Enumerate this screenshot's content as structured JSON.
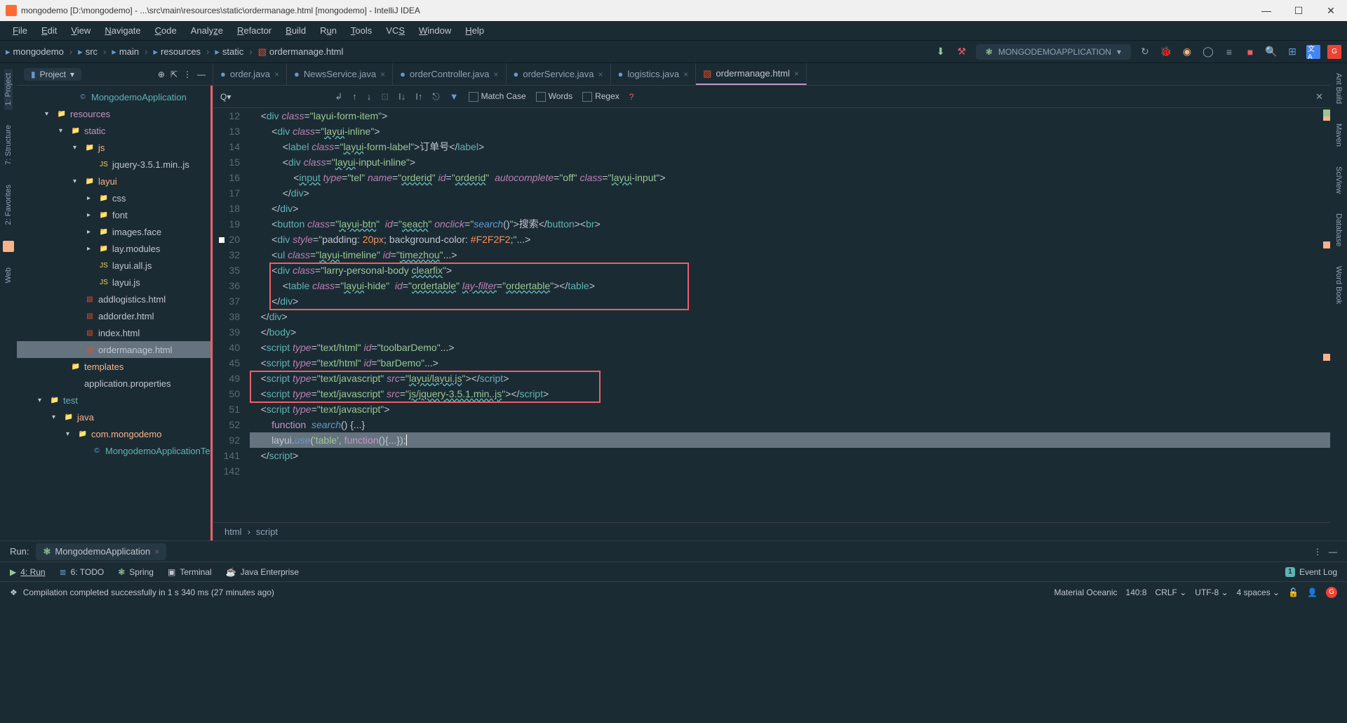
{
  "titlebar": {
    "text": "mongodemo [D:\\mongodemo] - ...\\src\\main\\resources\\static\\ordermanage.html [mongodemo] - IntelliJ IDEA"
  },
  "menubar": [
    "File",
    "Edit",
    "View",
    "Navigate",
    "Code",
    "Analyze",
    "Refactor",
    "Build",
    "Run",
    "Tools",
    "VCS",
    "Window",
    "Help"
  ],
  "breadcrumbs": [
    {
      "icon": "folder",
      "label": "mongodemo"
    },
    {
      "icon": "folder",
      "label": "src"
    },
    {
      "icon": "folder",
      "label": "main"
    },
    {
      "icon": "folder",
      "label": "resources"
    },
    {
      "icon": "folder",
      "label": "static"
    },
    {
      "icon": "html",
      "label": "ordermanage.html"
    }
  ],
  "runconfig": {
    "label": "MONGODEMOAPPLICATION"
  },
  "project": {
    "header": "Project"
  },
  "tree": [
    {
      "indent": 70,
      "chev": "",
      "icon": "class",
      "label": "MongodemoApplication",
      "cls": "cyan"
    },
    {
      "indent": 40,
      "chev": "▾",
      "icon": "folder",
      "label": "resources",
      "cls": "pink"
    },
    {
      "indent": 60,
      "chev": "▾",
      "icon": "folder",
      "label": "static",
      "cls": "pink"
    },
    {
      "indent": 80,
      "chev": "▾",
      "icon": "folder",
      "label": "js",
      "cls": "yellow-txt"
    },
    {
      "indent": 100,
      "chev": "",
      "icon": "js",
      "label": "jquery-3.5.1.min..js",
      "cls": ""
    },
    {
      "indent": 80,
      "chev": "▾",
      "icon": "folder",
      "label": "layui",
      "cls": "yellow-txt"
    },
    {
      "indent": 100,
      "chev": "▸",
      "icon": "folder",
      "label": "css",
      "cls": ""
    },
    {
      "indent": 100,
      "chev": "▸",
      "icon": "folder",
      "label": "font",
      "cls": ""
    },
    {
      "indent": 100,
      "chev": "▸",
      "icon": "folder",
      "label": "images.face",
      "cls": ""
    },
    {
      "indent": 100,
      "chev": "▸",
      "icon": "folder",
      "label": "lay.modules",
      "cls": ""
    },
    {
      "indent": 100,
      "chev": "",
      "icon": "js",
      "label": "layui.all.js",
      "cls": ""
    },
    {
      "indent": 100,
      "chev": "",
      "icon": "js",
      "label": "layui.js",
      "cls": ""
    },
    {
      "indent": 80,
      "chev": "",
      "icon": "html",
      "label": "addlogistics.html",
      "cls": ""
    },
    {
      "indent": 80,
      "chev": "",
      "icon": "html",
      "label": "addorder.html",
      "cls": ""
    },
    {
      "indent": 80,
      "chev": "",
      "icon": "html",
      "label": "index.html",
      "cls": ""
    },
    {
      "indent": 80,
      "chev": "",
      "icon": "html",
      "label": "ordermanage.html",
      "cls": "",
      "selected": true
    },
    {
      "indent": 60,
      "chev": "",
      "icon": "folder",
      "label": "templates",
      "cls": "yellow-txt"
    },
    {
      "indent": 60,
      "chev": "",
      "icon": "xml",
      "label": "application.properties",
      "cls": ""
    },
    {
      "indent": 30,
      "chev": "▾",
      "icon": "folder",
      "label": "test",
      "cls": "cyan"
    },
    {
      "indent": 50,
      "chev": "▾",
      "icon": "folder",
      "label": "java",
      "cls": "yellow-txt"
    },
    {
      "indent": 70,
      "chev": "▾",
      "icon": "folder",
      "label": "com.mongodemo",
      "cls": "yellow-txt"
    },
    {
      "indent": 90,
      "chev": "",
      "icon": "class",
      "label": "MongodemoApplicationTe",
      "cls": "cyan"
    }
  ],
  "tabs": [
    {
      "icon": "java",
      "label": "order.java"
    },
    {
      "icon": "java",
      "label": "NewsService.java"
    },
    {
      "icon": "java",
      "label": "orderController.java"
    },
    {
      "icon": "java",
      "label": "orderService.java"
    },
    {
      "icon": "java",
      "label": "logistics.java"
    },
    {
      "icon": "html",
      "label": "ordermanage.html",
      "active": true
    }
  ],
  "find": {
    "placeholder": "Q▾",
    "match_case": "Match Case",
    "words": "Words",
    "regex": "Regex"
  },
  "code": {
    "lines": [
      {
        "n": 12,
        "html": "    <span class='t-brk'>&lt;</span><span class='t-tag'>div</span> <span class='t-attr'>class</span><span class='t-brk'>=</span><span class='t-str'>\"layui-form-item\"</span><span class='t-brk'>&gt;</span>"
      },
      {
        "n": 13,
        "html": "        <span class='t-brk'>&lt;</span><span class='t-tag'>div</span> <span class='t-attr'>class</span><span class='t-brk'>=</span><span class='t-str'>\"<span class='wavy'>layui</span>-inline\"</span><span class='t-brk'>&gt;</span>"
      },
      {
        "n": 14,
        "html": "            <span class='t-brk'>&lt;</span><span class='t-tag'>label</span> <span class='t-attr'>class</span><span class='t-brk'>=</span><span class='t-str'>\"<span class='wavy'>layui</span>-form-label\"</span><span class='t-brk'>&gt;</span><span class='t-txt'>订单号</span><span class='t-brk'>&lt;/</span><span class='t-tag'>label</span><span class='t-brk'>&gt;</span>"
      },
      {
        "n": 15,
        "html": "            <span class='t-brk'>&lt;</span><span class='t-tag'>div</span> <span class='t-attr'>class</span><span class='t-brk'>=</span><span class='t-str'>\"<span class='wavy'>layui</span>-input-inline\"</span><span class='t-brk'>&gt;</span>"
      },
      {
        "n": 16,
        "html": "                <span class='t-brk'>&lt;</span><span class='t-tag wavy'>input</span> <span class='t-attr'>type</span><span class='t-brk'>=</span><span class='t-str'>\"tel\"</span> <span class='t-attr'>name</span><span class='t-brk'>=</span><span class='t-str'>\"<span class='wavy'>orderid</span>\"</span> <span class='t-attr'>id</span><span class='t-brk'>=</span><span class='t-str'>\"<span class='wavy'>orderid</span>\"</span>  <span class='t-attr'>autocomplete</span><span class='t-brk'>=</span><span class='t-str'>\"off\"</span> <span class='t-attr'>class</span><span class='t-brk'>=</span><span class='t-str'>\"<span class='wavy'>layui</span>-input\"</span><span class='t-brk'>&gt;</span>"
      },
      {
        "n": 17,
        "html": "            <span class='t-brk'>&lt;/</span><span class='t-tag'>div</span><span class='t-brk'>&gt;</span>"
      },
      {
        "n": 18,
        "html": "        <span class='t-brk'>&lt;/</span><span class='t-tag'>div</span><span class='t-brk'>&gt;</span>"
      },
      {
        "n": 19,
        "html": "        <span class='t-brk'>&lt;</span><span class='t-tag'>button</span> <span class='t-attr'>class</span><span class='t-brk'>=</span><span class='t-str'>\"<span class='wavy'>layui-btn</span>\"</span>  <span class='t-attr'>id</span><span class='t-brk'>=</span><span class='t-str'>\"<span class='wavy'>seach</span>\"</span> <span class='t-attr'>onclick</span><span class='t-brk'>=</span><span class='t-str'>\"</span><span class='t-fn'>search</span><span class='t-brk'>()</span><span class='t-str'>\"</span><span class='t-brk'>&gt;</span><span class='t-txt'>搜索</span><span class='t-brk'>&lt;/</span><span class='t-tag'>button</span><span class='t-brk'>&gt;&lt;</span><span class='t-tag'>br</span><span class='t-brk'>&gt;</span>"
      },
      {
        "n": 20,
        "marker": true,
        "html": "        <span class='t-brk'>&lt;</span><span class='t-tag'>div</span> <span class='t-attr'>style</span><span class='t-brk'>=</span><span class='t-str'>\"</span><span class='t-txt'>padding: </span><span class='t-num'>20px</span><span class='t-txt'>; background-color: </span><span class='t-num'>#F2F2F2</span><span class='t-txt'>;</span><span class='t-str'>\"</span><span class='t-brk'>...&gt;</span>"
      },
      {
        "n": 32,
        "html": "        <span class='t-brk'>&lt;</span><span class='t-tag'>ul</span> <span class='t-attr'>class</span><span class='t-brk'>=</span><span class='t-str'>\"<span class='wavy'>layui</span>-timeline\"</span> <span class='t-attr'>id</span><span class='t-brk'>=</span><span class='t-str'>\"<span class='wavy'>timezhou</span>\"</span><span class='t-brk'>...&gt;</span>"
      },
      {
        "n": 35,
        "html": "        <span class='t-brk'>&lt;</span><span class='t-tag'>div</span> <span class='t-attr'>class</span><span class='t-brk'>=</span><span class='t-str'>\"larry-personal-body <span class='wavy'>clearfix</span>\"</span><span class='t-brk'>&gt;</span>"
      },
      {
        "n": 36,
        "html": "            <span class='t-brk'>&lt;</span><span class='t-tag'>table</span> <span class='t-attr'>class</span><span class='t-brk'>=</span><span class='t-str'>\"<span class='wavy'>layui</span>-hide\"</span>  <span class='t-attr'>id</span><span class='t-brk'>=</span><span class='t-str'>\"<span class='wavy'>ordertable</span>\"</span> <span class='t-attr wavy'>lay-filter</span><span class='t-brk'>=</span><span class='t-str'>\"<span class='wavy'>ordertable</span>\"</span><span class='t-brk'>&gt;&lt;/</span><span class='t-tag'>table</span><span class='t-brk'>&gt;</span>"
      },
      {
        "n": 37,
        "html": "        <span class='t-brk'>&lt;/</span><span class='t-tag'>div</span><span class='t-brk'>&gt;</span>"
      },
      {
        "n": 38,
        "html": "    <span class='t-brk'>&lt;/</span><span class='t-tag'>div</span><span class='t-brk'>&gt;</span>"
      },
      {
        "n": 39,
        "html": "    <span class='t-brk'>&lt;/</span><span class='t-tag'>body</span><span class='t-brk'>&gt;</span>"
      },
      {
        "n": 40,
        "html": "    <span class='t-brk'>&lt;</span><span class='t-tag'>script</span> <span class='t-attr'>type</span><span class='t-brk'>=</span><span class='t-str'>\"text/html\"</span> <span class='t-attr'>id</span><span class='t-brk'>=</span><span class='t-str'>\"toolbarDemo\"</span><span class='t-brk'>...&gt;</span>"
      },
      {
        "n": 45,
        "html": "    <span class='t-brk'>&lt;</span><span class='t-tag'>script</span> <span class='t-attr'>type</span><span class='t-brk'>=</span><span class='t-str'>\"text/html\"</span> <span class='t-attr'>id</span><span class='t-brk'>=</span><span class='t-str'>\"barDemo\"</span><span class='t-brk'>...&gt;</span>"
      },
      {
        "n": 49,
        "html": "    <span class='t-brk'>&lt;</span><span class='t-tag'>script</span> <span class='t-attr'>type</span><span class='t-brk'>=</span><span class='t-str'>\"text/javascript\"</span> <span class='t-attr'>src</span><span class='t-brk'>=</span><span class='t-str'>\"<span class='wavy'>layui/layui.js</span>\"</span><span class='t-brk'>&gt;&lt;/</span><span class='t-tag'>script</span><span class='t-brk'>&gt;</span>"
      },
      {
        "n": 50,
        "html": "    <span class='t-brk'>&lt;</span><span class='t-tag'>script</span> <span class='t-attr'>type</span><span class='t-brk'>=</span><span class='t-str'>\"text/javascript\"</span> <span class='t-attr'>src</span><span class='t-brk'>=</span><span class='t-str'>\"<span class='wavy'>js/jquery-3.5.1.min..js</span>\"</span><span class='t-brk'>&gt;&lt;/</span><span class='t-tag'>script</span><span class='t-brk'>&gt;</span>"
      },
      {
        "n": 51,
        "html": "    <span class='t-brk'>&lt;</span><span class='t-tag'>script</span> <span class='t-attr'>type</span><span class='t-brk'>=</span><span class='t-str'>\"text/javascript\"</span><span class='t-brk'>&gt;</span>"
      },
      {
        "n": 52,
        "html": "        <span class='t-key'>function</span>  <span class='t-fn'>search</span><span class='t-brk'>()</span> <span class='t-brk'>{...}</span>"
      },
      {
        "n": 92,
        "hilite": true,
        "html": "        <span class='t-txt'>layui.</span><span class='t-fn'>use</span><span class='t-brk'>(</span><span class='t-str'>'table'</span><span class='t-brk'>, </span><span class='t-key'>function</span><span class='t-brk'>()</span><span class='t-brk'>{...}</span><span class='t-brk'>);</span><span class='caret'></span>"
      },
      {
        "n": 141,
        "html": "    <span class='t-brk'>&lt;/</span><span class='t-tag'>script</span><span class='t-brk'>&gt;</span>"
      },
      {
        "n": 142,
        "html": ""
      }
    ]
  },
  "crumb2": [
    "html",
    "script"
  ],
  "sideLeft": [
    "1: Project",
    "7: Structure",
    "2: Favorites",
    "Web"
  ],
  "sideRight": [
    "Ant Build",
    "Maven",
    "SciView",
    "Database",
    "Word Book"
  ],
  "run": {
    "label": "Run:",
    "tab": "MongodemoApplication"
  },
  "bottom": {
    "run": "4: Run",
    "todo": "6: TODO",
    "spring": "Spring",
    "terminal": "Terminal",
    "java": "Java Enterprise",
    "eventlog": "Event Log"
  },
  "status": {
    "msg": "Compilation completed successfully in 1 s 340 ms (27 minutes ago)",
    "theme": "Material Oceanic",
    "pos": "140:8",
    "eol": "CRLF",
    "enc": "UTF-8",
    "indent": "4 spaces"
  }
}
